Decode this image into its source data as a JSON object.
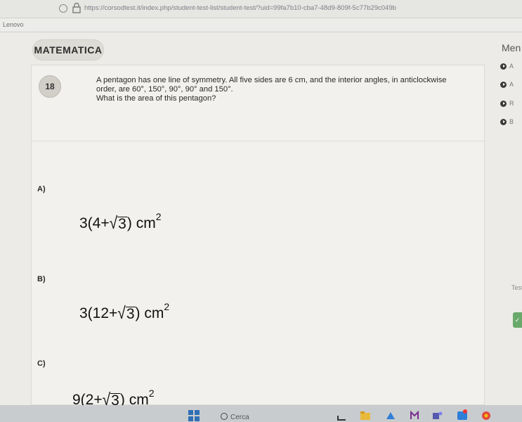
{
  "browser": {
    "url": "https://corsodtest.it/index.php/student-test-list/student-test/?uid=99fa7b10-cba7-48d9-809f-5c77b29c049b",
    "brand": "Lenovo"
  },
  "header": {
    "subject": "MATEMATICA",
    "menu_label": "Men"
  },
  "question": {
    "number": "18",
    "line1": "A pentagon has one line of symmetry. All five sides are 6 cm, and the interior angles, in anticlockwise",
    "line2": "order, are 60°, 150°, 90°, 90° and 150°.",
    "line3": "What is the area of this pentagon?"
  },
  "options": [
    {
      "label": "A)",
      "coef": "3(4+",
      "radicand": "3",
      "close": ")",
      "unit": "cm",
      "exp": "2"
    },
    {
      "label": "B)",
      "coef": "3(12+",
      "radicand": "3",
      "close": ")",
      "unit": "cm",
      "exp": "2"
    },
    {
      "label": "C)",
      "coef": "9(2+",
      "radicand": "3",
      "close": ")",
      "unit": "cm",
      "exp": "2"
    }
  ],
  "sidebar": {
    "items": [
      {
        "text": "A"
      },
      {
        "text": "A"
      },
      {
        "text": "R"
      },
      {
        "text": "B"
      }
    ],
    "test_label": "Test",
    "check_glyph": "✓"
  },
  "taskbar": {
    "search_label": "Cerca",
    "accent": "#2f6fb5"
  }
}
